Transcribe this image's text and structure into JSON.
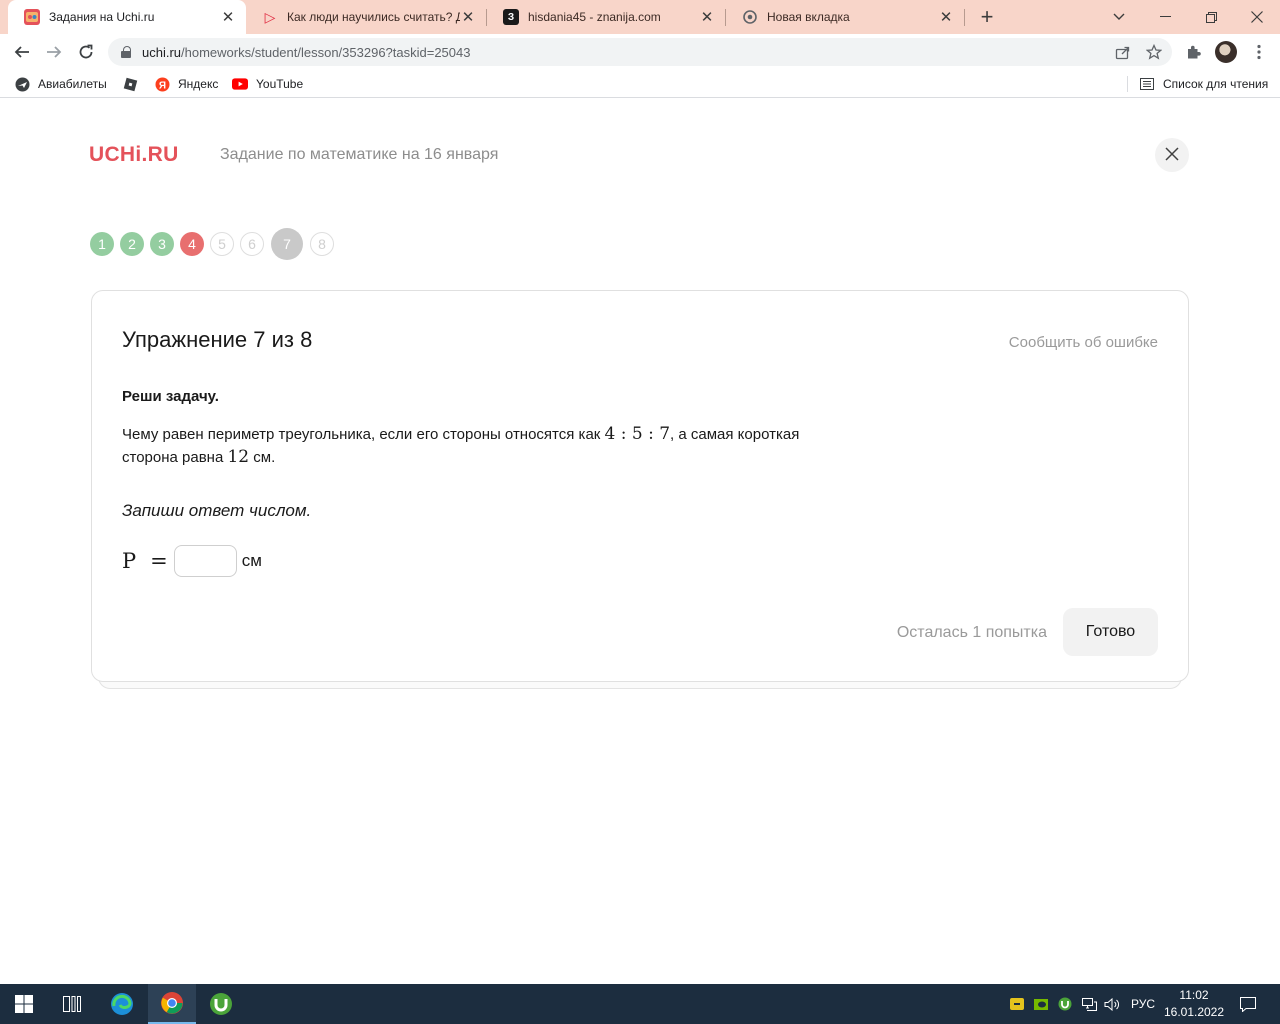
{
  "browser": {
    "tabs": [
      {
        "title": "Задания на Uchi.ru",
        "active": true,
        "favicon": "uchi-favicon"
      },
      {
        "title": "Как люди научились считать? Д",
        "active": false,
        "favicon": "video-favicon"
      },
      {
        "title": "hisdania45 - znanija.com",
        "active": false,
        "favicon": "znanija-favicon"
      },
      {
        "title": "Новая вкладка",
        "active": false,
        "favicon": "chrome-favicon"
      }
    ],
    "url": {
      "host": "uchi.ru",
      "path": "/homeworks/student/lesson/353296?taskid=25043"
    },
    "bookmarks": [
      "Авиабилеты",
      "",
      "Яндекс",
      "YouTube"
    ],
    "reading_list": "Список для чтения"
  },
  "page": {
    "logo": "UCHi.RU",
    "title": "Задание по математике на 16 января",
    "steps": [
      {
        "label": "1",
        "state": "done"
      },
      {
        "label": "2",
        "state": "done"
      },
      {
        "label": "3",
        "state": "done"
      },
      {
        "label": "4",
        "state": "error"
      },
      {
        "label": "5",
        "state": "todo"
      },
      {
        "label": "6",
        "state": "todo"
      },
      {
        "label": "7",
        "state": "current"
      },
      {
        "label": "8",
        "state": "todo"
      }
    ],
    "exercise": {
      "heading": "Упражнение 7 из 8",
      "report": "Сообщить об ошибке",
      "task_heading": "Реши задачу.",
      "text_part1": "Чему равен периметр треугольника, если его стороны относятся как ",
      "ratio": "4 : 5 : 7",
      "text_part2": ", а самая короткая сторона равна ",
      "side": "12",
      "text_part3": " см.",
      "hint": "Запиши ответ числом.",
      "answer_var": "P",
      "answer_eq": "=",
      "answer_value": "",
      "answer_unit": "см",
      "attempts": "Осталась 1 попытка",
      "done_label": "Готово"
    }
  },
  "taskbar": {
    "language": "РУС",
    "time": "11:02",
    "date": "16.01.2022"
  },
  "colors": {
    "brand": "#e4525a",
    "step_done": "#94cda0",
    "step_error": "#e86f6f",
    "step_current": "#c9c9c9",
    "tabstrip": "#f8d5c9",
    "taskbar": "#1c2d3f"
  }
}
